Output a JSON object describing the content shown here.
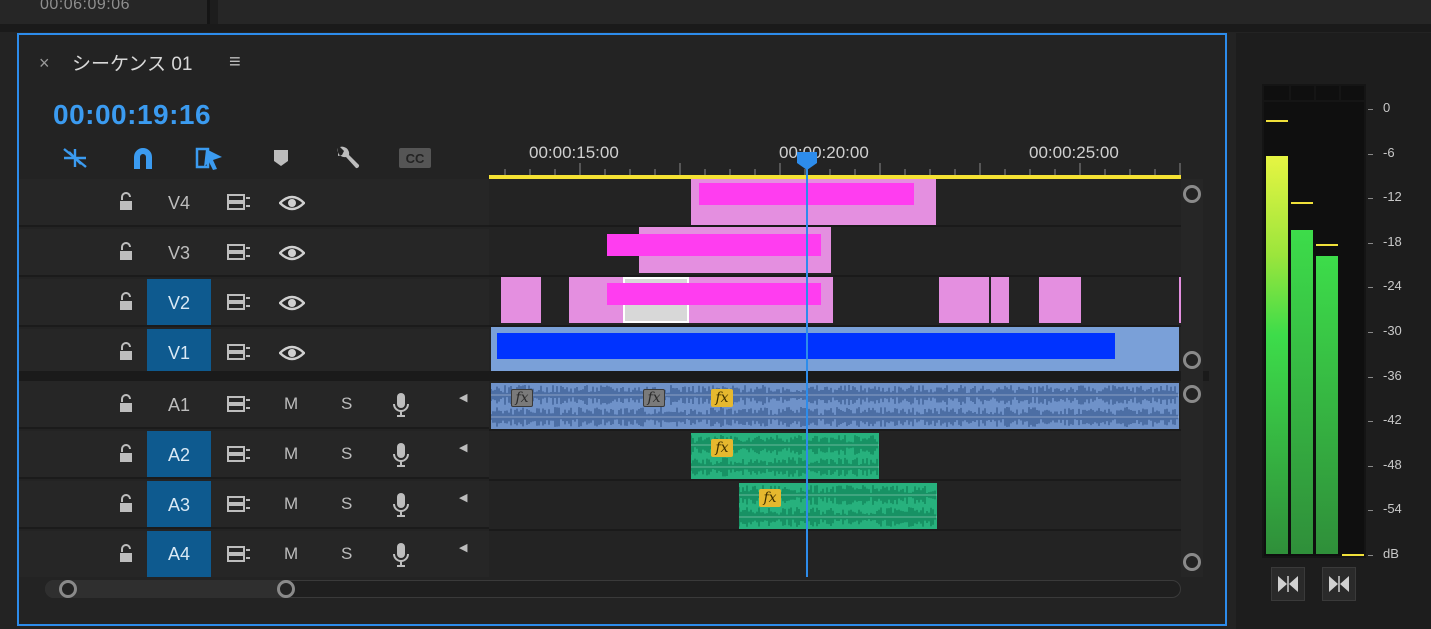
{
  "top": {
    "timecode": "00:06:09:06"
  },
  "panel": {
    "close_label": "×",
    "title": "シーケンス 01",
    "menu_label": "≡",
    "playhead_timecode": "00:00:19:16"
  },
  "ruler": {
    "labels": [
      "00:00:15:00",
      "00:00:20:00",
      "00:00:25:00"
    ]
  },
  "video_tracks": [
    {
      "name": "V4",
      "targeted": false
    },
    {
      "name": "V3",
      "targeted": false
    },
    {
      "name": "V2",
      "targeted": true
    },
    {
      "name": "V1",
      "targeted": true
    }
  ],
  "audio_tracks": [
    {
      "name": "A1",
      "targeted": false,
      "m": "M",
      "s": "S"
    },
    {
      "name": "A2",
      "targeted": true,
      "m": "M",
      "s": "S"
    },
    {
      "name": "A3",
      "targeted": true,
      "m": "M",
      "s": "S"
    },
    {
      "name": "A4",
      "targeted": true,
      "m": "M",
      "s": "S"
    }
  ],
  "fx_label": "fx",
  "meter": {
    "scale": [
      "0",
      "-6",
      "-12",
      "-18",
      "-24",
      "-30",
      "-36",
      "-42",
      "-48",
      "-54",
      "dB"
    ],
    "colors": {
      "top": "#e6f542",
      "mid": "#3ddc4a",
      "low": "#2f8f3a",
      "peak": "#f0e03a"
    }
  },
  "colors": {
    "accent": "#2d8ceb",
    "video_clip": "#e48fe0",
    "magenta_bar": "#ff3df0",
    "v1_clip": "#7aa0d8",
    "v1_bar": "#0033ff",
    "audio_a1": "#6f92c9",
    "audio_green": "#27b17d",
    "yellow_line": "#f5e233"
  }
}
